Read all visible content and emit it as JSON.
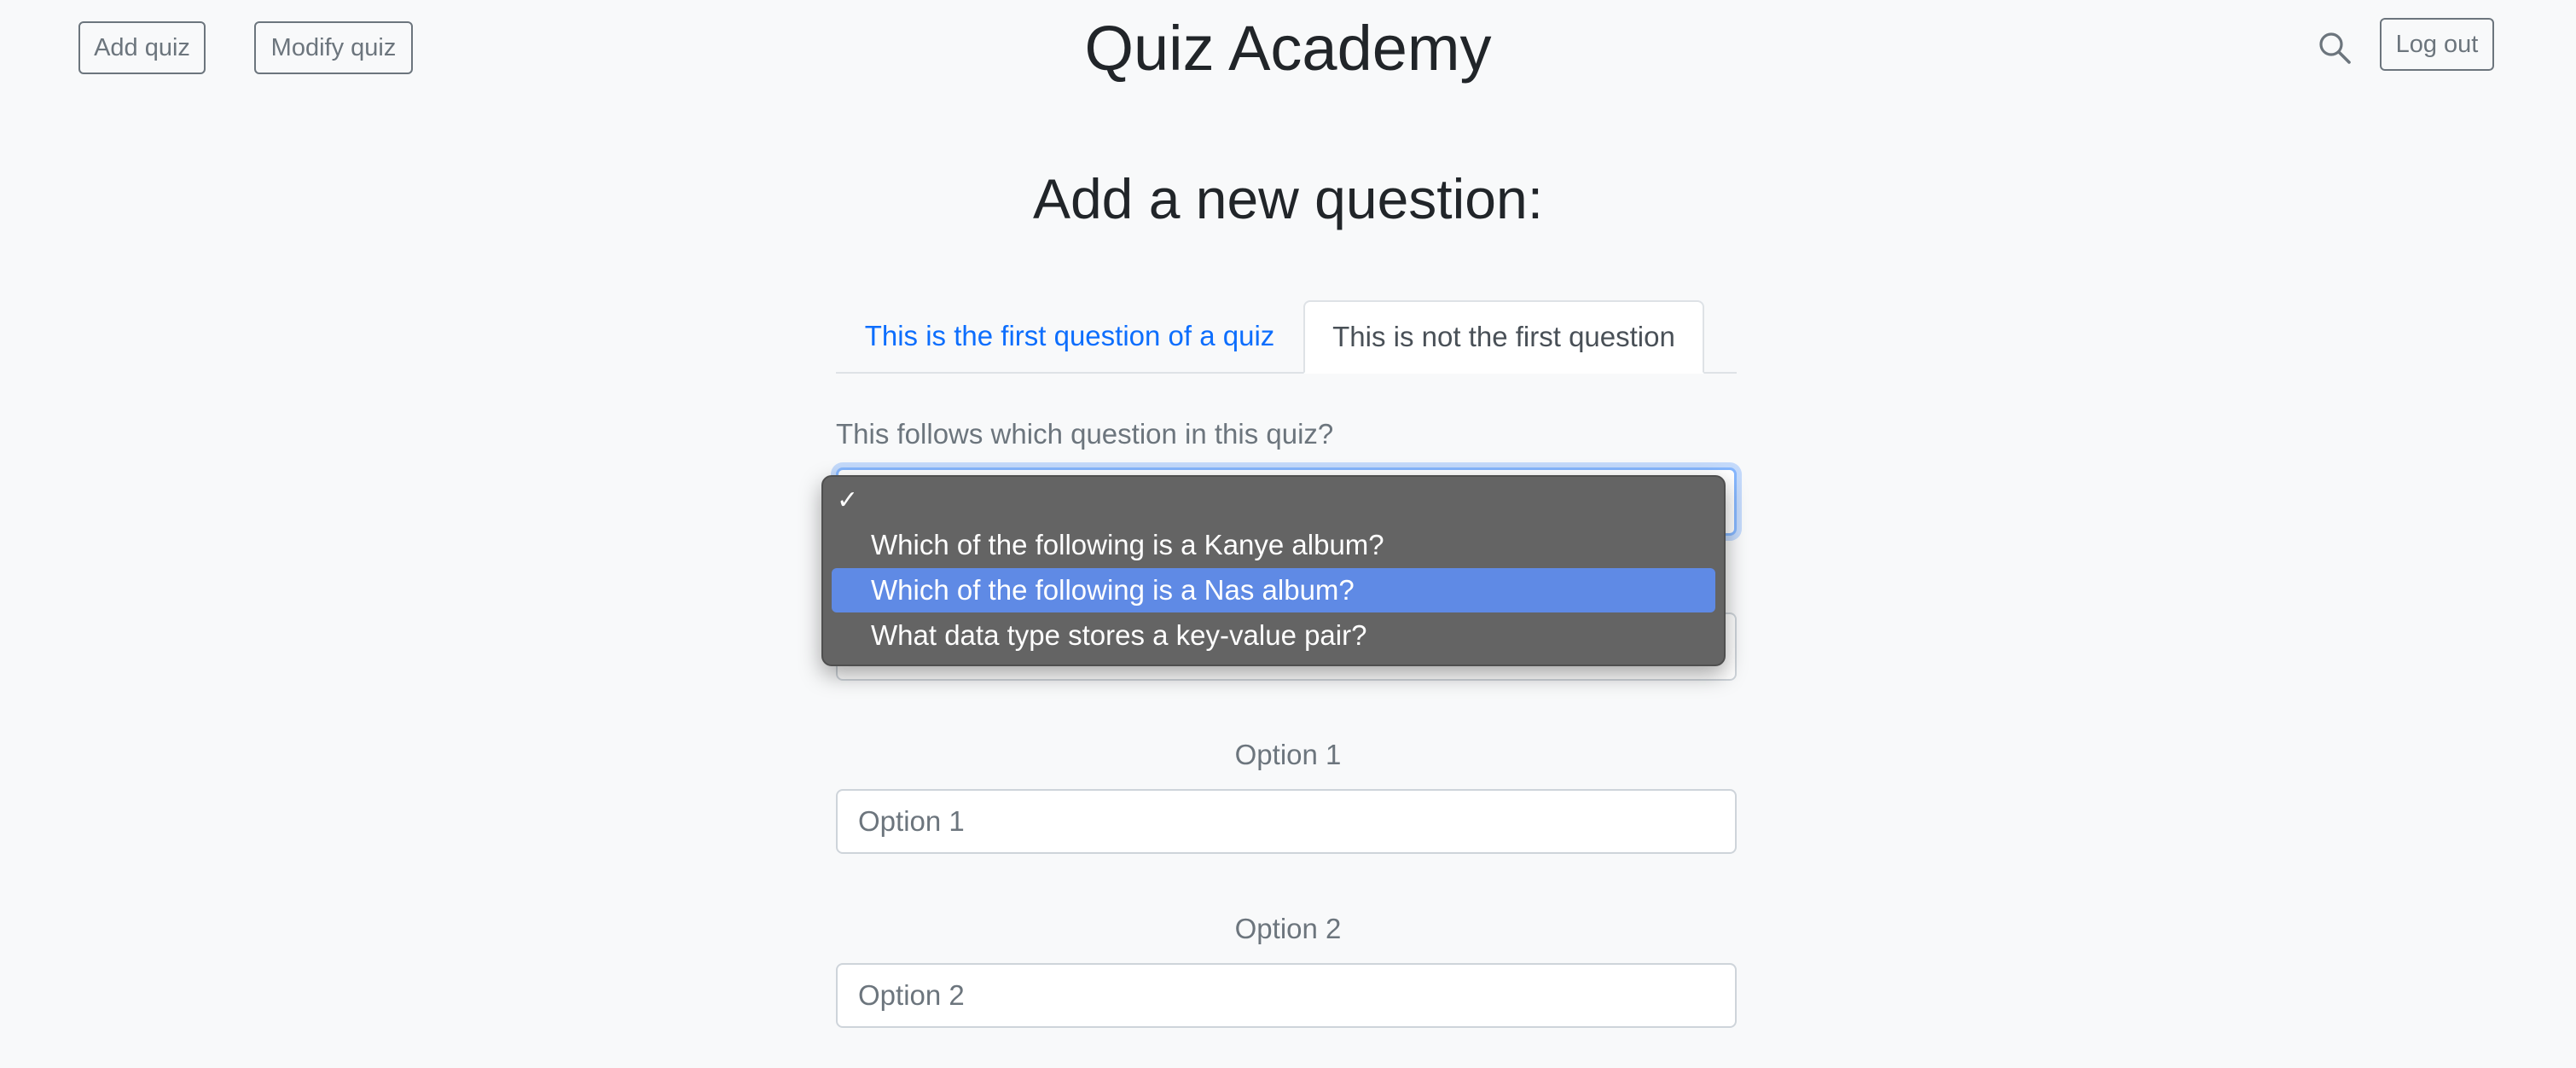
{
  "header": {
    "add_quiz_label": "Add quiz",
    "modify_quiz_label": "Modify quiz",
    "brand": "Quiz Academy",
    "search_icon": "search-icon",
    "logout_label": "Log out"
  },
  "main": {
    "title": "Add a new question:",
    "tabs": [
      {
        "label": "This is the first question of a quiz",
        "active": false
      },
      {
        "label": "This is not the first question",
        "active": true
      }
    ],
    "follow_label": "This follows which question in this quiz?",
    "dropdown": {
      "checkmark": "✓",
      "options": [
        {
          "label": "Which of the following is a Kanye album?",
          "highlighted": false
        },
        {
          "label": "Which of the following is a Nas album?",
          "highlighted": true
        },
        {
          "label": "What data type stores a key-value pair?",
          "highlighted": false
        }
      ]
    },
    "options": [
      {
        "label": "Option 1",
        "placeholder": "Option 1"
      },
      {
        "label": "Option 2",
        "placeholder": "Option 2"
      }
    ]
  },
  "colors": {
    "background": "#f8f9fa",
    "link_blue": "#0d6efd",
    "dropdown_bg": "#646464",
    "dropdown_highlight": "#5f8ae5",
    "muted_text": "#6c757d"
  }
}
